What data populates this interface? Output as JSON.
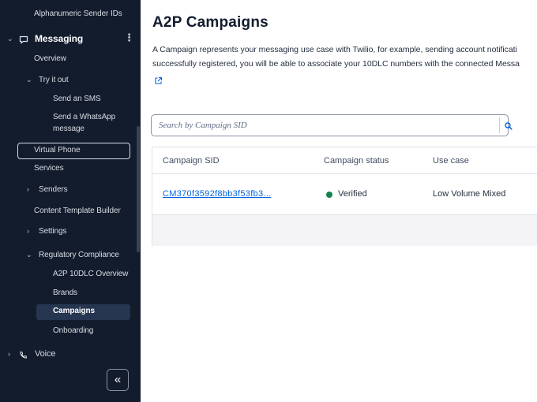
{
  "sidebar": {
    "alphanumeric": "Alphanumeric Sender IDs",
    "messaging": "Messaging",
    "overview": "Overview",
    "try_it_out": "Try it out",
    "send_sms": "Send an SMS",
    "send_whatsapp_line1": "Send a WhatsApp",
    "send_whatsapp_line2": "message",
    "virtual_phone": "Virtual Phone",
    "services": "Services",
    "senders": "Senders",
    "content_template_builder": "Content Template Builder",
    "settings": "Settings",
    "regulatory_compliance": "Regulatory Compliance",
    "a2p_overview": "A2P 10DLC Overview",
    "brands": "Brands",
    "campaigns": "Campaigns",
    "onboarding": "Onboarding",
    "voice": "Voice",
    "collapse_glyph": "«"
  },
  "main": {
    "title": "A2P Campaigns",
    "description_line1": "A Campaign represents your messaging use case with Twilio, for example, sending account notificati",
    "description_line2": "successfully registered, you will be able to associate your 10DLC numbers with the connected Messa",
    "search_placeholder": "Search by Campaign SID"
  },
  "table": {
    "columns": [
      "Campaign SID",
      "Campaign status",
      "Use case"
    ],
    "rows": [
      {
        "campaign_sid": "CM370f3592f8bb3f53fb3...",
        "status": "Verified",
        "use_case": "Low Volume Mixed"
      }
    ]
  },
  "colors": {
    "sidebar_bg": "#121c2d",
    "link": "#0263e0",
    "status_verified": "#14824d"
  },
  "icons": [
    "chat-bubble-icon",
    "phone-icon",
    "kebab-menu-icon",
    "external-link-icon",
    "search-icon",
    "double-chevron-left-icon"
  ]
}
